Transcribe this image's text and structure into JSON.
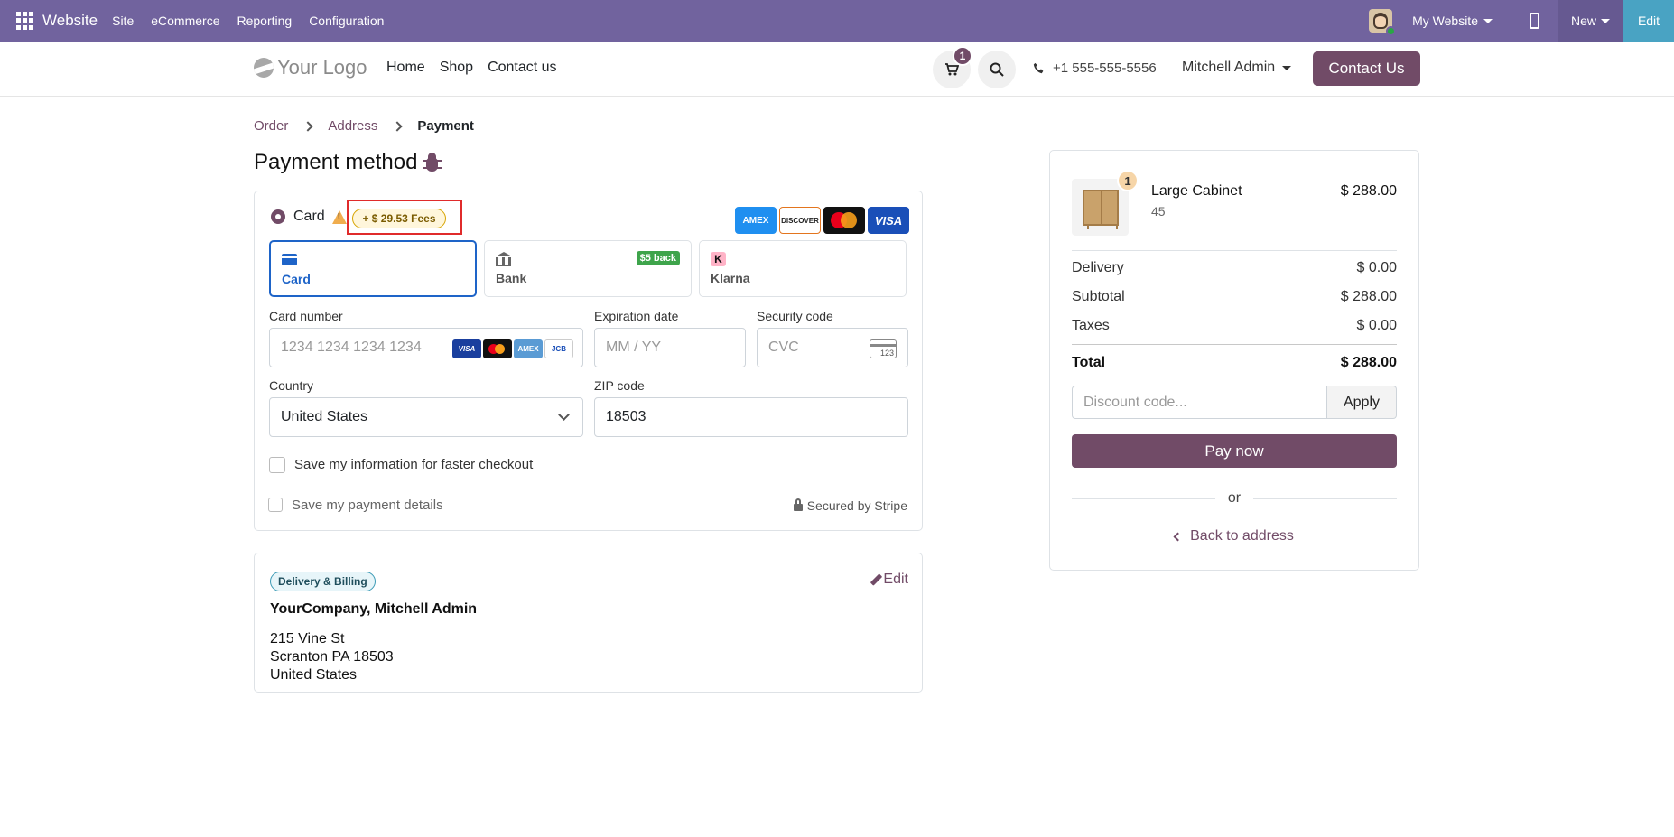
{
  "adminbar": {
    "brand": "Website",
    "menus": [
      "Site",
      "eCommerce",
      "Reporting",
      "Configuration"
    ],
    "my_website": "My Website",
    "new_label": "New",
    "edit_label": "Edit"
  },
  "header": {
    "logo": "Your Logo",
    "nav": [
      "Home",
      "Shop",
      "Contact us"
    ],
    "cart_count": "1",
    "phone": "+1 555-555-5556",
    "user": "Mitchell Admin",
    "contact_button": "Contact Us"
  },
  "breadcrumb": [
    "Order",
    "Address",
    "Payment"
  ],
  "page_title": "Payment method",
  "payment": {
    "option_label": "Card",
    "fee_badge": "+ $ 29.53 Fees",
    "brands": [
      "AMEX",
      "DISCOVER",
      "",
      "VISA"
    ],
    "methods": [
      {
        "label": "Card",
        "active": true
      },
      {
        "label": "Bank",
        "badge": "$5 back"
      },
      {
        "label": "Klarna",
        "icon_text": "K"
      }
    ],
    "fields": {
      "card_number_label": "Card number",
      "card_number_placeholder": "1234 1234 1234 1234",
      "card_brands": [
        "VISA",
        "",
        "AMEX",
        "JCB"
      ],
      "expiration_label": "Expiration date",
      "expiration_placeholder": "MM / YY",
      "security_label": "Security code",
      "security_placeholder": "CVC",
      "cvc_icon_text": "123",
      "country_label": "Country",
      "country_value": "United States",
      "zip_label": "ZIP code",
      "zip_value": "18503"
    },
    "save_info": "Save my information for faster checkout",
    "save_payment": "Save my payment details",
    "secured": "Secured by Stripe"
  },
  "address": {
    "badge": "Delivery & Billing",
    "edit": "Edit",
    "name": "YourCompany, Mitchell Admin",
    "lines": [
      "215 Vine St",
      "Scranton PA 18503",
      "United States"
    ]
  },
  "summary": {
    "qty": "1",
    "product_name": "Large Cabinet",
    "product_sub": "45",
    "product_price": "$ 288.00",
    "rows": [
      {
        "label": "Delivery",
        "value": "$ 0.00"
      },
      {
        "label": "Subtotal",
        "value": "$ 288.00"
      },
      {
        "label": "Taxes",
        "value": "$ 0.00"
      }
    ],
    "total_label": "Total",
    "total_value": "$ 288.00",
    "discount_placeholder": "Discount code...",
    "apply": "Apply",
    "pay_now": "Pay now",
    "or": "or",
    "back": "Back to address"
  },
  "colors": {
    "admin_bar": "#71639e",
    "brand_primary": "#714b67",
    "edit_button": "#49a3c3",
    "active_tab": "#1e64c8"
  }
}
